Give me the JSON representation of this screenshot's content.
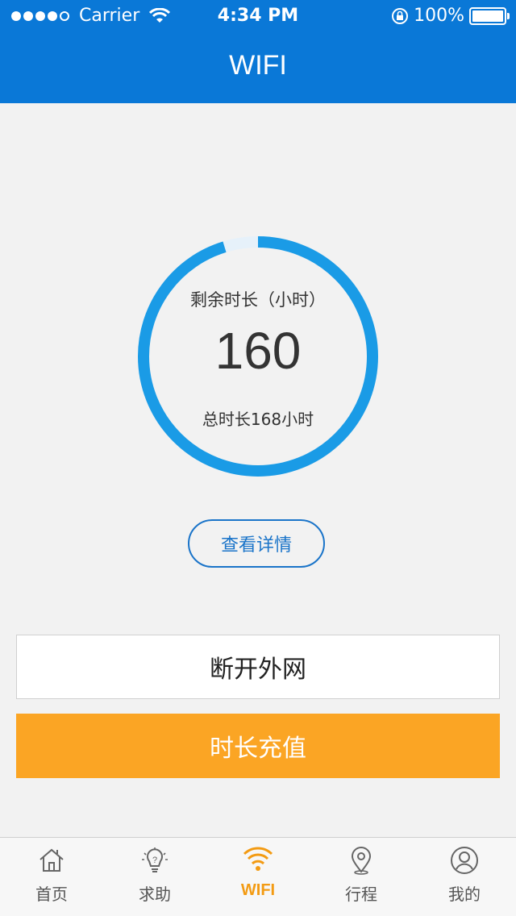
{
  "status_bar": {
    "carrier": "Carrier",
    "time": "4:34 PM",
    "battery": "100%",
    "signal_dots": 5,
    "signal_filled": 4
  },
  "header": {
    "title": "WIFI",
    "color": "#0a78d7"
  },
  "usage": {
    "remaining_label": "剩余时长（小时）",
    "remaining_value": "160",
    "total_label": "总时长168小时",
    "remaining_hours": 160,
    "total_hours": 168,
    "ring_color": "#1a9be6",
    "ring_track_color": "#e6f1fa"
  },
  "buttons": {
    "details": "查看详情",
    "disconnect": "断开外网",
    "recharge": "时长充值",
    "recharge_color": "#fba524"
  },
  "tabbar": {
    "items": [
      {
        "label": "首页",
        "icon": "home-icon"
      },
      {
        "label": "求助",
        "icon": "lightbulb-question-icon"
      },
      {
        "label": "WIFI",
        "icon": "wifi-icon",
        "active": true
      },
      {
        "label": "行程",
        "icon": "map-pin-icon"
      },
      {
        "label": "我的",
        "icon": "user-icon"
      }
    ],
    "active_color": "#f39b13"
  }
}
